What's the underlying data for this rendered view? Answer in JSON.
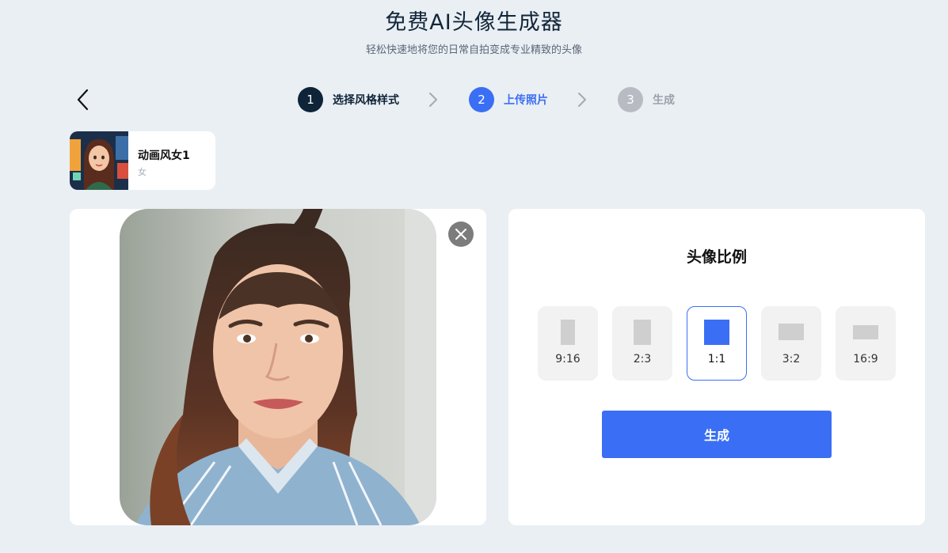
{
  "header": {
    "title": "免费AI头像生成器",
    "subtitle": "轻松快速地将您的日常自拍变成专业精致的头像"
  },
  "nav": {
    "back_icon": "chevron-left-icon"
  },
  "stepper": {
    "steps": [
      {
        "number": "1",
        "label": "选择风格样式",
        "state": "completed"
      },
      {
        "number": "2",
        "label": "上传照片",
        "state": "active"
      },
      {
        "number": "3",
        "label": "生成",
        "state": "pending"
      }
    ],
    "separator_icon": "chevron-right-icon"
  },
  "selected_style": {
    "name": "动画风女1",
    "gender": "女"
  },
  "upload": {
    "close_icon": "close-icon"
  },
  "ratio": {
    "title": "头像比例",
    "options": [
      {
        "label": "9:16",
        "selected": false
      },
      {
        "label": "2:3",
        "selected": false
      },
      {
        "label": "1:1",
        "selected": true
      },
      {
        "label": "3:2",
        "selected": false
      },
      {
        "label": "16:9",
        "selected": false
      }
    ],
    "generate_label": "生成"
  },
  "colors": {
    "accent": "#3a6ff5",
    "dark": "#0f2438",
    "muted": "#b8bcc2",
    "background": "#eaeff4"
  }
}
